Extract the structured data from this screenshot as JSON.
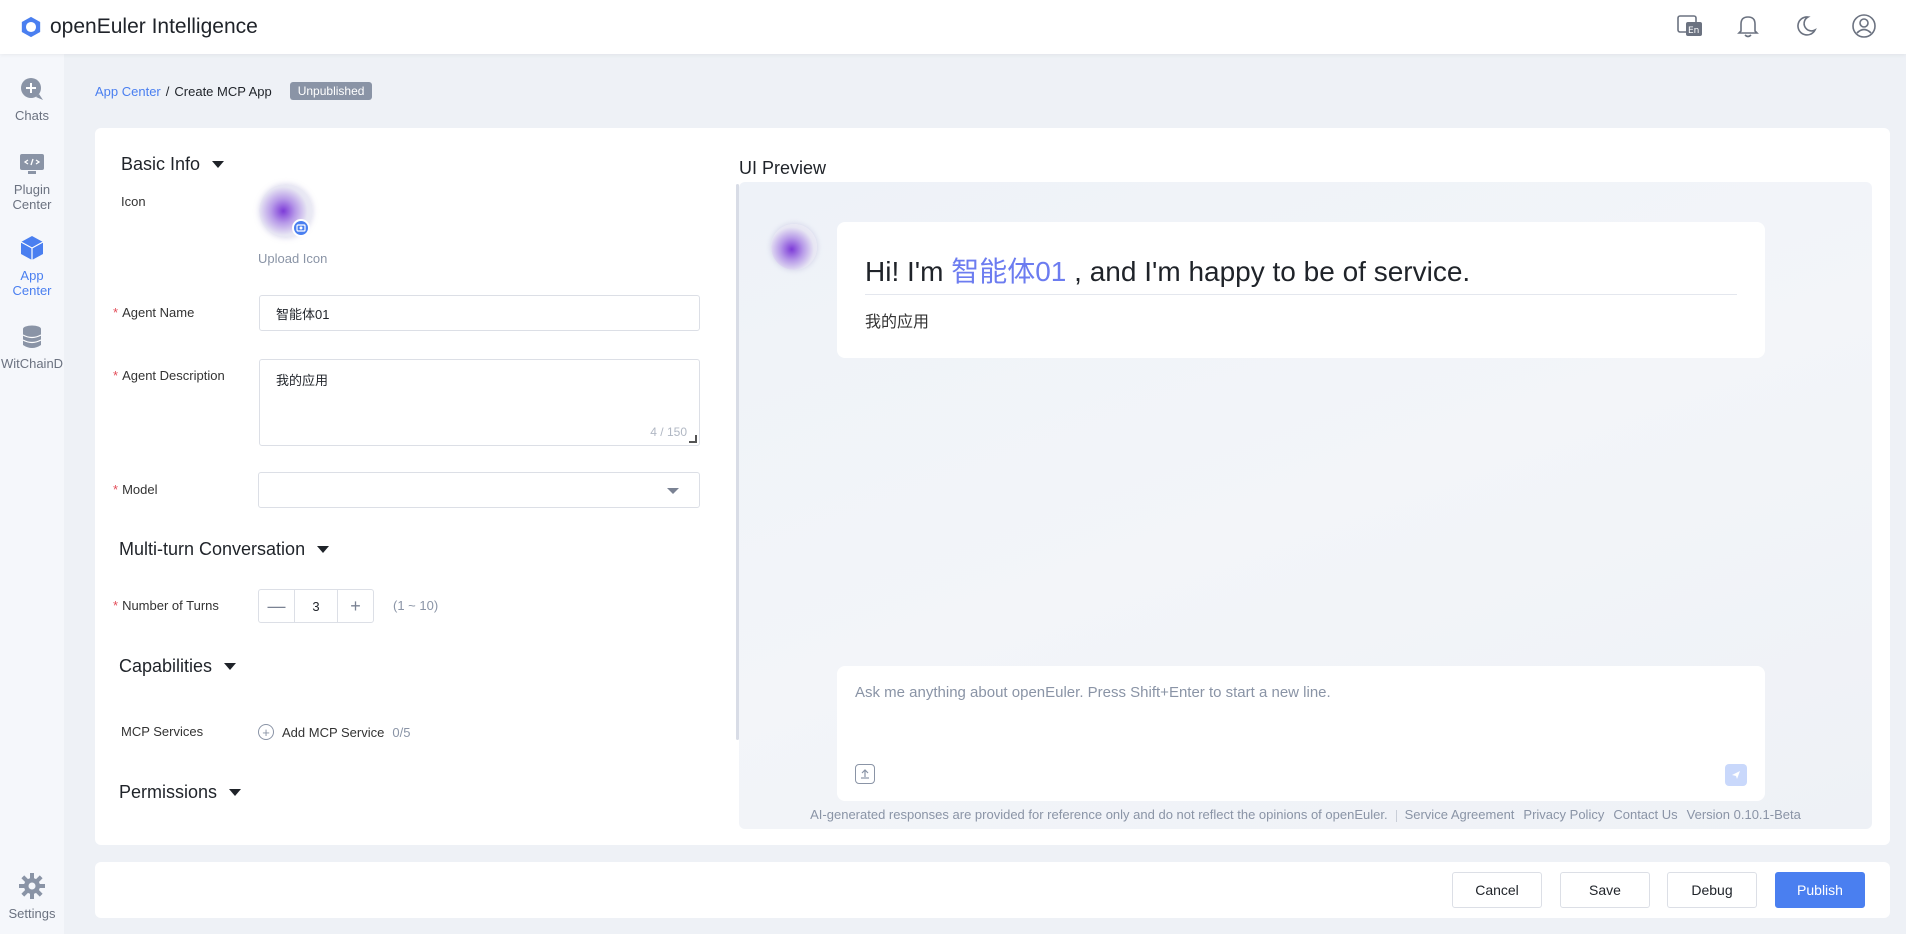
{
  "app": {
    "brand_name": "openEuler Intelligence",
    "brand_color": "#4a7ff0"
  },
  "topbar": {
    "icons": [
      "language-switch-icon",
      "bell-icon",
      "moon-icon",
      "user-icon"
    ]
  },
  "sidebar": {
    "items": [
      {
        "label": "Chats",
        "icon": "chat-plus-icon"
      },
      {
        "label": "Plugin Center",
        "label_lines": [
          "Plugin",
          "Center"
        ],
        "icon": "plugin-monitor-icon"
      },
      {
        "label": "App Center",
        "label_lines": [
          "App",
          "Center"
        ],
        "icon": "cube-icon",
        "active": true
      },
      {
        "label": "WitChainD",
        "icon": "database-icon"
      },
      {
        "label": "Settings",
        "icon": "gear-icon"
      }
    ]
  },
  "breadcrumb": {
    "parent": "App Center",
    "separator": "/",
    "current": "Create MCP App",
    "status_badge": "Unpublished"
  },
  "form": {
    "basic_info_title": "Basic Info",
    "icon_label": "Icon",
    "upload_icon": "Upload Icon",
    "agent_name_label": "Agent Name",
    "agent_name_value": "智能体01",
    "agent_desc_label": "Agent Description",
    "agent_desc_value": "我的应用",
    "agent_desc_counter": "4 / 150",
    "model_label": "Model",
    "model_value": "",
    "multi_turn_title": "Multi-turn Conversation",
    "turns_label": "Number of Turns",
    "turns_value": "3",
    "turns_range": "(1 ~ 10)",
    "capabilities_title": "Capabilities",
    "mcp_label": "MCP Services",
    "add_mcp": "Add MCP Service",
    "mcp_count": "0/5",
    "permissions_title": "Permissions",
    "required_mark": "*"
  },
  "preview": {
    "title": "UI Preview",
    "greeting_prefix": "Hi! I'm",
    "greeting_name": "智能体01",
    "greeting_suffix": ", and I'm happy to be of service.",
    "greeting_desc": "我的应用",
    "chat_placeholder": "Ask me anything about openEuler. Press Shift+Enter to start a new line.",
    "disclaimer": "AI-generated responses are provided for reference only and do not reflect the opinions of openEuler.",
    "links": [
      "Service Agreement",
      "Privacy Policy",
      "Contact Us"
    ],
    "version": "Version 0.10.1-Beta"
  },
  "actions": {
    "cancel": "Cancel",
    "save": "Save",
    "debug": "Debug",
    "publish": "Publish"
  }
}
